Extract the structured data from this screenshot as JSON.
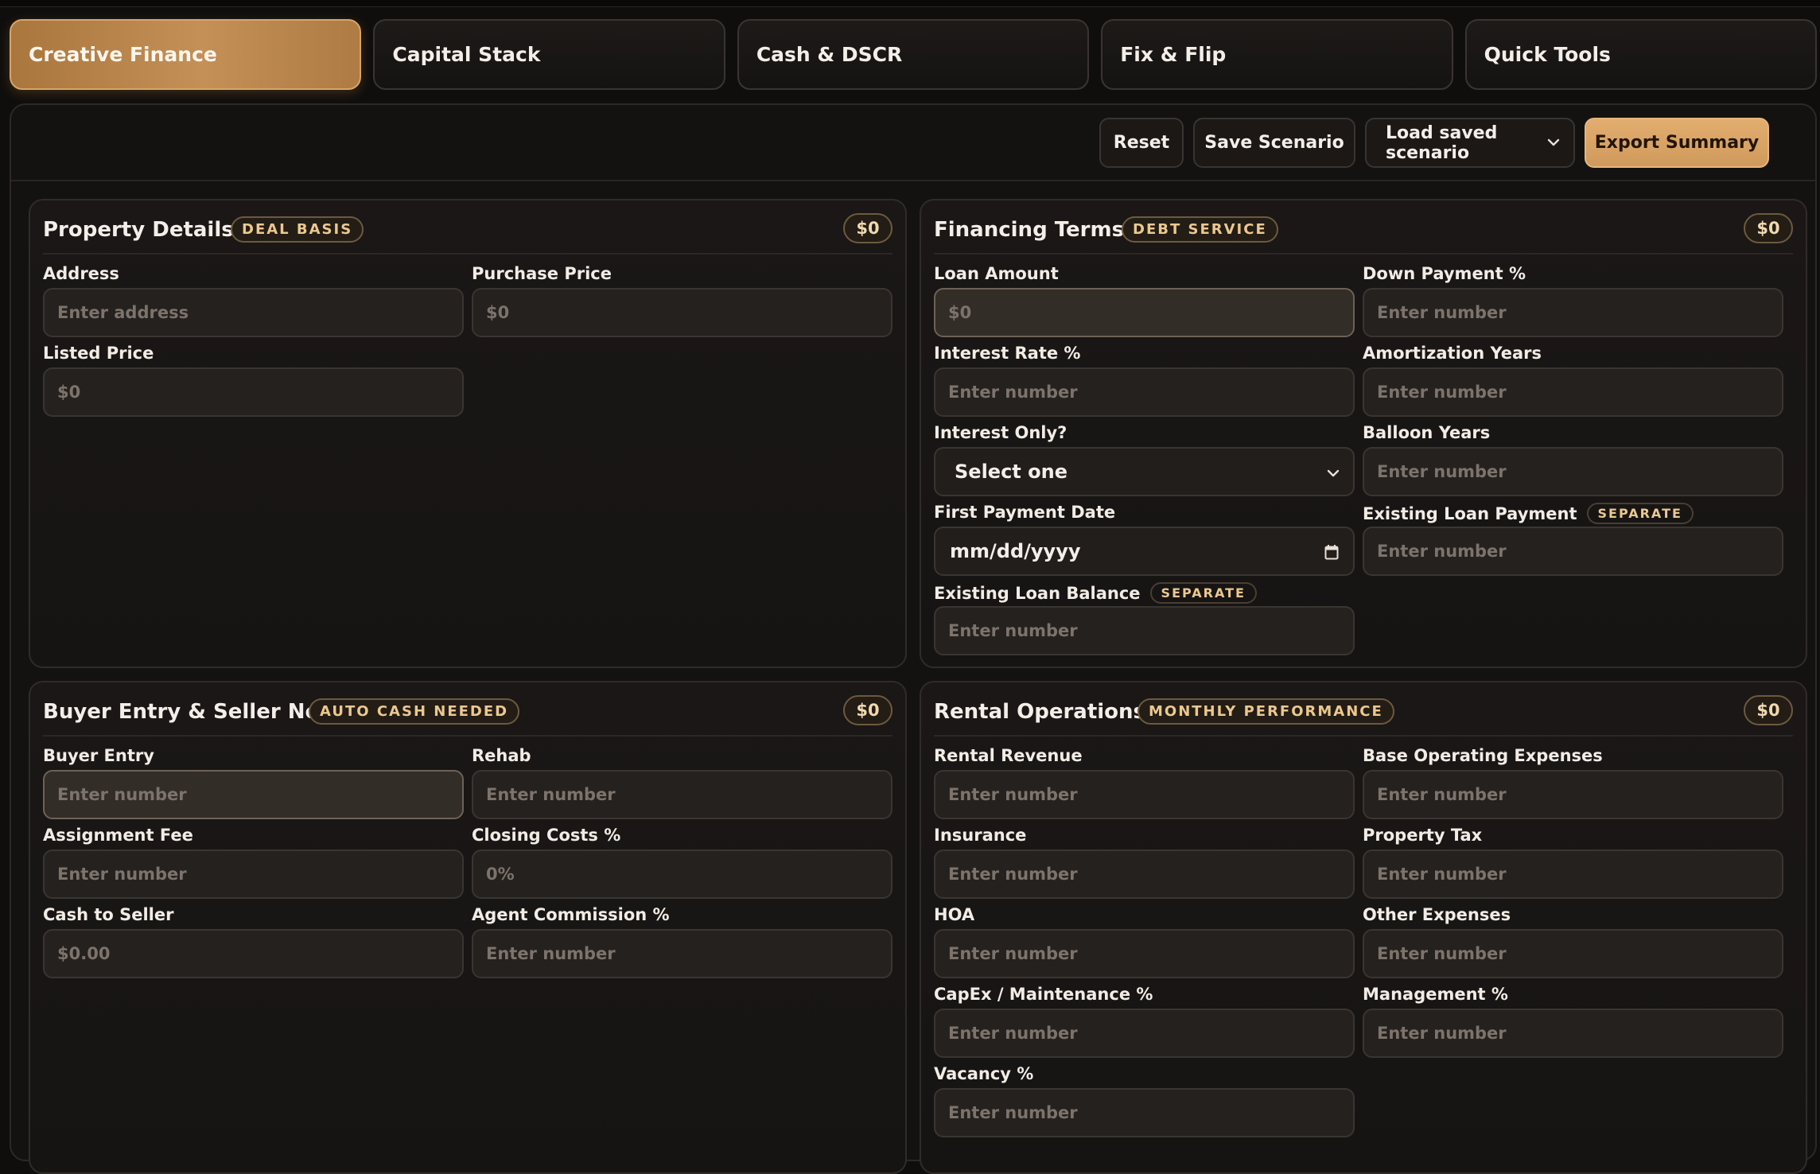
{
  "tabs": [
    "Creative Finance",
    "Capital Stack",
    "Cash & DSCR",
    "Fix & Flip",
    "Quick Tools"
  ],
  "toolbar": {
    "reset": "Reset",
    "save": "Save Scenario",
    "load": "Load saved scenario",
    "export": "Export Summary"
  },
  "property": {
    "title": "Property Details",
    "badge": "DEAL BASIS",
    "amount": "$0",
    "address_label": "Address",
    "address_placeholder": "Enter address",
    "purchase_label": "Purchase Price",
    "purchase_placeholder": "$0",
    "listed_label": "Listed Price",
    "listed_placeholder": "$0"
  },
  "financing": {
    "title": "Financing Terms",
    "badge": "DEBT SERVICE",
    "amount": "$0",
    "loan_amount_label": "Loan Amount",
    "loan_amount_placeholder": "$0",
    "down_payment_label": "Down Payment %",
    "interest_rate_label": "Interest Rate %",
    "amortization_label": "Amortization Years",
    "interest_only_label": "Interest Only?",
    "interest_only_value": "Select one",
    "balloon_label": "Balloon Years",
    "first_payment_label": "First Payment Date",
    "first_payment_value": "mm/dd/yyyy",
    "existing_payment_label": "Existing Loan Payment",
    "existing_balance_label": "Existing Loan Balance",
    "separate_badge": "SEPARATE",
    "number_placeholder": "Enter number"
  },
  "buyer": {
    "title": "Buyer Entry & Seller Net",
    "badge": "AUTO CASH NEEDED",
    "amount": "$0",
    "buyer_entry_label": "Buyer Entry",
    "rehab_label": "Rehab",
    "assignment_label": "Assignment Fee",
    "closing_label": "Closing Costs %",
    "closing_placeholder": "0%",
    "cash_seller_label": "Cash to Seller",
    "cash_seller_placeholder": "$0.00",
    "agent_label": "Agent Commission %",
    "number_placeholder": "Enter number"
  },
  "rental": {
    "title": "Rental Operations",
    "badge": "MONTHLY PERFORMANCE",
    "amount": "$0",
    "revenue_label": "Rental Revenue",
    "base_opex_label": "Base Operating Expenses",
    "insurance_label": "Insurance",
    "property_tax_label": "Property Tax",
    "hoa_label": "HOA",
    "other_label": "Other Expenses",
    "capex_label": "CapEx / Maintenance %",
    "management_label": "Management %",
    "vacancy_label": "Vacancy %",
    "number_placeholder": "Enter number"
  }
}
